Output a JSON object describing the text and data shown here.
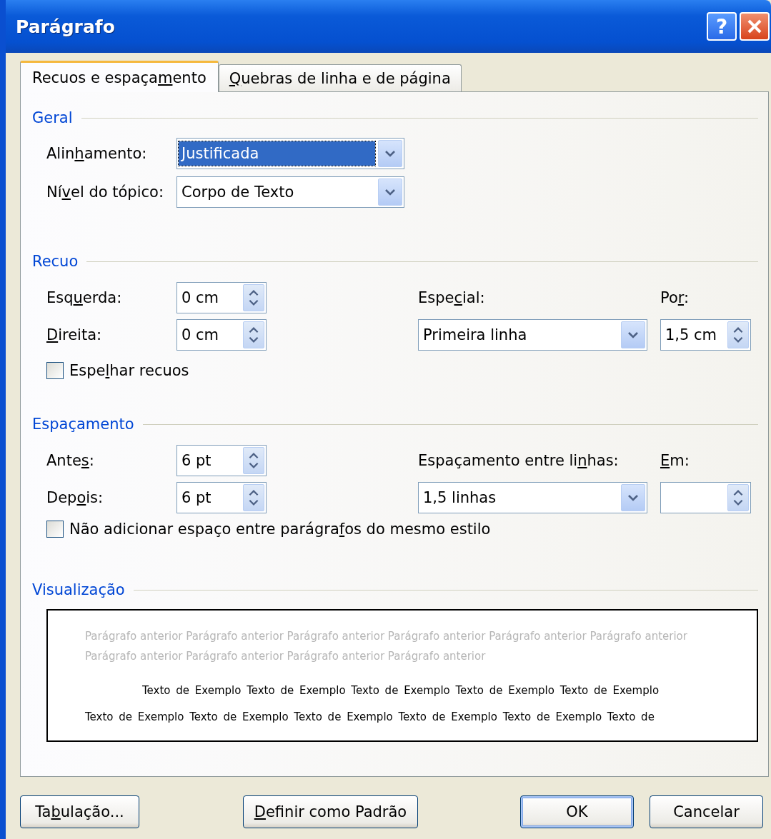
{
  "window": {
    "title": "Parágrafo",
    "help_label": "?"
  },
  "tabs": [
    {
      "label_parts": [
        {
          "text": "Recuos e espaça",
          "mnemonic": false
        },
        {
          "text": "m",
          "mnemonic": true
        },
        {
          "text": "ento",
          "mnemonic": false
        }
      ],
      "selected": true
    },
    {
      "label_parts": [
        {
          "text": "Q",
          "mnemonic": true
        },
        {
          "text": "uebras de linha e de página",
          "mnemonic": false
        }
      ],
      "selected": false
    }
  ],
  "general": {
    "heading": "Geral",
    "alignment": {
      "label_parts": [
        {
          "text": "Alin",
          "mnemonic": false
        },
        {
          "text": "h",
          "mnemonic": true
        },
        {
          "text": "amento:",
          "mnemonic": false
        }
      ],
      "value": "Justificada",
      "focused": true
    },
    "outline_level": {
      "label_parts": [
        {
          "text": "Ní",
          "mnemonic": false
        },
        {
          "text": "v",
          "mnemonic": true
        },
        {
          "text": "el do tópico:",
          "mnemonic": false
        }
      ],
      "value": "Corpo de Texto",
      "focused": false
    }
  },
  "indentation": {
    "heading": "Recuo",
    "left": {
      "label_parts": [
        {
          "text": "Esq",
          "mnemonic": false
        },
        {
          "text": "u",
          "mnemonic": true
        },
        {
          "text": "erda:",
          "mnemonic": false
        }
      ],
      "value": "0 cm"
    },
    "right": {
      "label_parts": [
        {
          "text": "D",
          "mnemonic": true
        },
        {
          "text": "ireita:",
          "mnemonic": false
        }
      ],
      "value": "0 cm"
    },
    "special": {
      "label_parts": [
        {
          "text": "Espe",
          "mnemonic": false
        },
        {
          "text": "c",
          "mnemonic": true
        },
        {
          "text": "ial:",
          "mnemonic": false
        }
      ],
      "value": "Primeira linha"
    },
    "by": {
      "label_parts": [
        {
          "text": "Po",
          "mnemonic": false
        },
        {
          "text": "r",
          "mnemonic": true
        },
        {
          "text": ":",
          "mnemonic": false
        }
      ],
      "value": "1,5 cm"
    },
    "mirror": {
      "label_parts": [
        {
          "text": "Espe",
          "mnemonic": false
        },
        {
          "text": "l",
          "mnemonic": true
        },
        {
          "text": "har recuos",
          "mnemonic": false
        }
      ],
      "checked": false
    }
  },
  "spacing": {
    "heading": "Espaçamento",
    "before": {
      "label_parts": [
        {
          "text": "Ante",
          "mnemonic": false
        },
        {
          "text": "s",
          "mnemonic": true
        },
        {
          "text": ":",
          "mnemonic": false
        }
      ],
      "value": "6 pt"
    },
    "after": {
      "label_parts": [
        {
          "text": "Dep",
          "mnemonic": false
        },
        {
          "text": "o",
          "mnemonic": true
        },
        {
          "text": "is:",
          "mnemonic": false
        }
      ],
      "value": "6 pt"
    },
    "line_spacing": {
      "label_parts": [
        {
          "text": "Espaçamento entre li",
          "mnemonic": false
        },
        {
          "text": "n",
          "mnemonic": true
        },
        {
          "text": "has:",
          "mnemonic": false
        }
      ],
      "value": "1,5 linhas"
    },
    "at": {
      "label_parts": [
        {
          "text": "E",
          "mnemonic": true
        },
        {
          "text": "m:",
          "mnemonic": false
        }
      ]
    },
    "dont_add": {
      "label_parts": [
        {
          "text": "Não adicionar espaço entre parágra",
          "mnemonic": false
        },
        {
          "text": "f",
          "mnemonic": true
        },
        {
          "text": "os do mesmo estilo",
          "mnemonic": false
        }
      ],
      "checked": false
    }
  },
  "preview": {
    "heading": "Visualização",
    "previous_text": "Parágrafo anterior Parágrafo anterior Parágrafo anterior Parágrafo anterior Parágrafo anterior Parágrafo anterior Parágrafo anterior Parágrafo anterior Parágrafo anterior Parágrafo anterior",
    "sample_text": "Texto de Exemplo Texto de Exemplo Texto de Exemplo Texto de Exemplo Texto de Exemplo Texto de Exemplo Texto de Exemplo Texto de Exemplo Texto de Exemplo Texto de Exemplo Texto de"
  },
  "buttons": [
    {
      "label_parts": [
        {
          "text": "Ta",
          "mnemonic": false
        },
        {
          "text": "b",
          "mnemonic": true
        },
        {
          "text": "ulação...",
          "mnemonic": false
        }
      ],
      "default": false
    },
    {
      "label_parts": [
        {
          "text": "D",
          "mnemonic": true
        },
        {
          "text": "efinir como Padrão",
          "mnemonic": false
        }
      ],
      "default": false
    },
    {
      "label_parts": [
        {
          "text": "OK",
          "mnemonic": false
        }
      ],
      "default": true
    },
    {
      "label_parts": [
        {
          "text": "Cancelar",
          "mnemonic": false
        }
      ],
      "default": false
    }
  ]
}
